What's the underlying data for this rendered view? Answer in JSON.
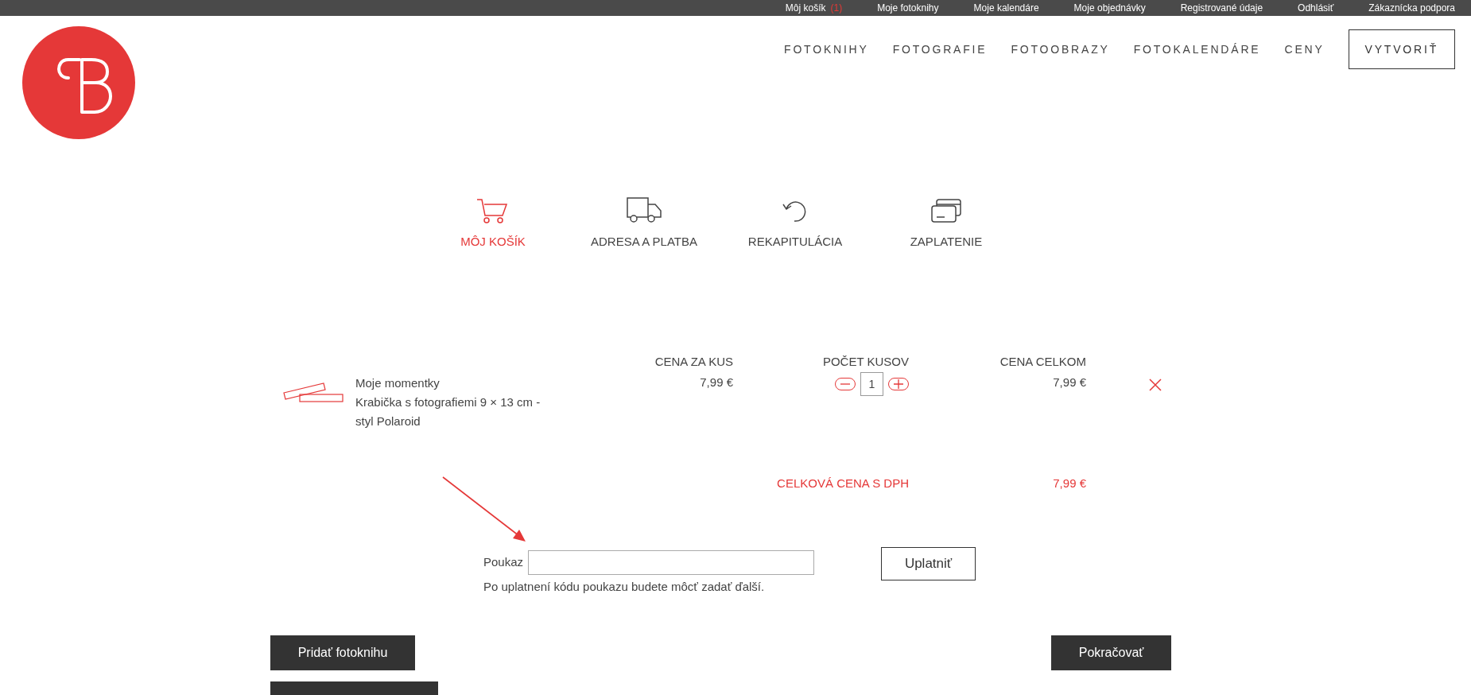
{
  "top_bar": {
    "items": [
      {
        "label": "Môj košík",
        "count": "(1)"
      },
      {
        "label": "Moje fotoknihy"
      },
      {
        "label": "Moje kalendáre"
      },
      {
        "label": "Moje objednávky"
      },
      {
        "label": "Registrované údaje"
      },
      {
        "label": "Odhlásiť"
      },
      {
        "label": "Zákaznícka podpora"
      }
    ]
  },
  "nav": {
    "items": [
      "FOTOKNIHY",
      "FOTOGRAFIE",
      "FOTOOBRAZY",
      "FOTOKALENDÁRE",
      "CENY"
    ],
    "cta": "VYTVORIŤ"
  },
  "steps": [
    {
      "kind": "cart",
      "label": "MÔJ KOŠÍK",
      "selected": true
    },
    {
      "kind": "truck",
      "label": "ADRESA A PLATBA",
      "selected": false
    },
    {
      "kind": "undo",
      "label": "REKAPITULÁCIA",
      "selected": false
    },
    {
      "kind": "card",
      "label": "ZAPLATENIE",
      "selected": false
    }
  ],
  "cart": {
    "columns": [
      "CENA ZA KUS",
      "POČET KUSOV",
      "CENA CELKOM"
    ],
    "items": [
      {
        "title": "Moje momentky",
        "description": "Krabička s fotografiemi 9 × 13 cm - styl Polaroid",
        "unit_price": "7,99 €",
        "quantity": "1",
        "total": "7,99 €"
      }
    ],
    "total_label": "CELKOVÁ CENA S DPH",
    "total_value": "7,99 €"
  },
  "voucher": {
    "label": "Poukaz",
    "button": "Uplatniť",
    "hint": "Po uplatnení kódu poukazu budete môcť zadať ďalší."
  },
  "buttons": {
    "left": "Pridať fotoknihu",
    "right": "Pokračovať"
  }
}
